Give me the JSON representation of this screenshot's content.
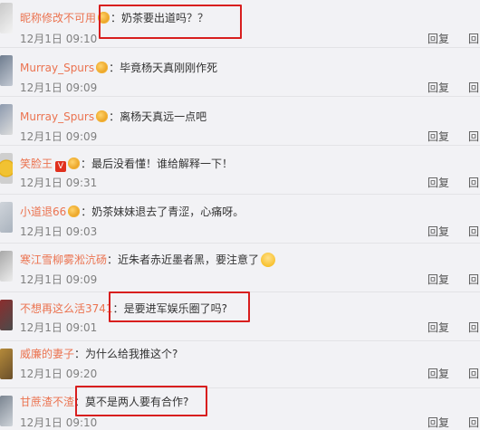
{
  "comments": [
    {
      "username": "昵称修改不可用",
      "text": "奶茶要出道吗？？",
      "time": "12月1日 09:10",
      "reply": "回复",
      "reply2": "回"
    },
    {
      "username": "Murray_Spurs",
      "text": "毕竟杨天真刚刚作死",
      "time": "12月1日 09:09",
      "reply": "回复",
      "reply2": "回"
    },
    {
      "username": "Murray_Spurs",
      "text": "离杨天真远一点吧",
      "time": "12月1日 09:09",
      "reply": "回复",
      "reply2": "回"
    },
    {
      "username": "笑脸王",
      "vip": "V",
      "text": "最后没看懂！谁给解释一下！",
      "time": "12月1日 09:31",
      "reply": "回复",
      "reply2": "回"
    },
    {
      "username": "小道退66",
      "text": "奶茶妹妹退去了青涩，心痛呀。",
      "time": "12月1日 09:03",
      "reply": "回复",
      "reply2": "回"
    },
    {
      "username": "寒江雪柳雾淞沆砀",
      "text": "近朱者赤近墨者黑，要注意了",
      "time": "12月1日 09:09",
      "reply": "回复",
      "reply2": "回"
    },
    {
      "username": "不想再这么活3741",
      "text": "是要进军娱乐圈了吗?",
      "time": "12月1日 09:01",
      "reply": "回复",
      "reply2": "回"
    },
    {
      "username": "威廉的妻子",
      "text": "为什么给我推这个?",
      "time": "12月1日 09:20",
      "reply": "回复",
      "reply2": "回"
    },
    {
      "username": "甘蔗渣不渣",
      "text": "莫不是两人要有合作?",
      "time": "12月1日 09:10",
      "reply": "回复",
      "reply2": "回"
    }
  ],
  "colors": {
    "username": "#eb7350",
    "highlight": "#d81e1e",
    "background": "#f2f2f5"
  }
}
